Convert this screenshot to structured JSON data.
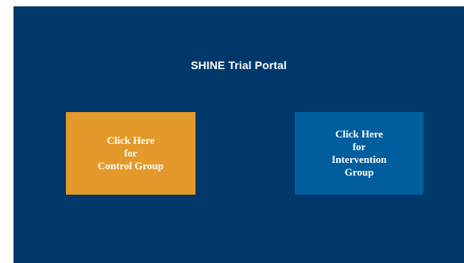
{
  "portal": {
    "title": "SHINE Trial Portal",
    "background_color": "#00386a"
  },
  "buttons": {
    "control": {
      "label": "Click Here\nfor\nControl Group",
      "color": "#e39a2a"
    },
    "intervention": {
      "label": "Click Here\nfor\nIntervention\nGroup",
      "color": "#005e9e"
    }
  }
}
